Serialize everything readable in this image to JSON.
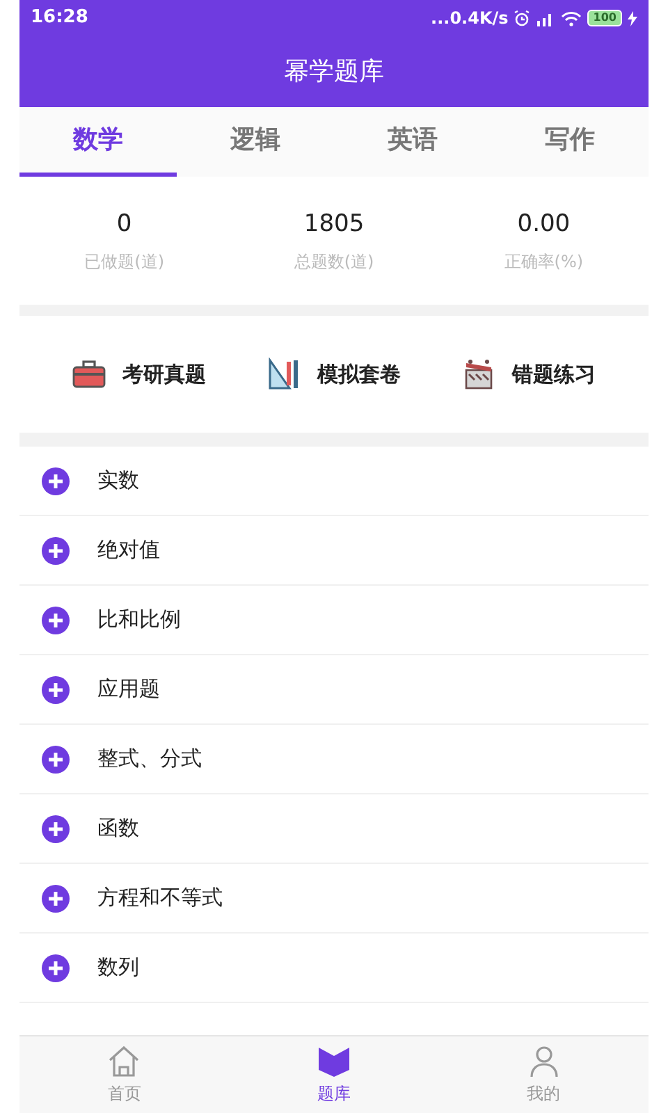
{
  "status_bar": {
    "time": "16:28",
    "network_speed": "...0.4K/s",
    "battery": "100"
  },
  "app_bar": {
    "title": "幂学题库"
  },
  "tabs": [
    {
      "label": "数学",
      "selected": true
    },
    {
      "label": "逻辑",
      "selected": false
    },
    {
      "label": "英语",
      "selected": false
    },
    {
      "label": "写作",
      "selected": false
    }
  ],
  "stats": [
    {
      "value": "0",
      "label": "已做题(道)"
    },
    {
      "value": "1805",
      "label": "总题数(道)"
    },
    {
      "value": "0.00",
      "label": "正确率(%)"
    }
  ],
  "shortcuts": [
    {
      "kind": "toolbox",
      "label": "考研真题"
    },
    {
      "kind": "ruler",
      "label": "模拟套卷"
    },
    {
      "kind": "clapper",
      "label": "错题练习"
    }
  ],
  "topics": [
    {
      "label": "实数",
      "expanded": false
    },
    {
      "label": "绝对值",
      "expanded": false
    },
    {
      "label": "比和比例",
      "expanded": false
    },
    {
      "label": "应用题",
      "expanded": false
    },
    {
      "label": "整式、分式",
      "expanded": false
    },
    {
      "label": "函数",
      "expanded": false
    },
    {
      "label": "方程和不等式",
      "expanded": false
    },
    {
      "label": "数列",
      "expanded": false
    }
  ],
  "bottom_nav": [
    {
      "kind": "home",
      "label": "首页",
      "selected": false
    },
    {
      "kind": "book",
      "label": "题库",
      "selected": true
    },
    {
      "kind": "person",
      "label": "我的",
      "selected": false
    }
  ]
}
